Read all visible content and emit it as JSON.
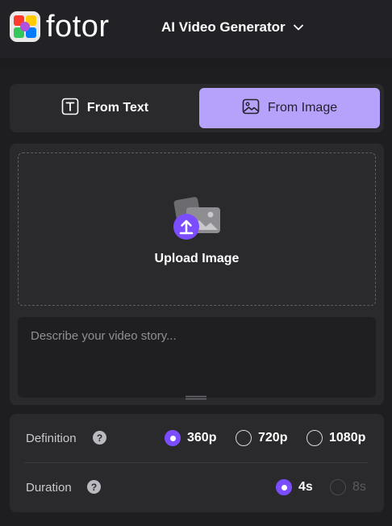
{
  "header": {
    "logo_text": "fotor",
    "product_menu": {
      "label": "AI Video Generator",
      "icon": "chevron-down-icon"
    }
  },
  "tabs": [
    {
      "label": "From Text",
      "icon": "text-icon",
      "active": false
    },
    {
      "label": "From Image",
      "icon": "image-icon",
      "active": true
    }
  ],
  "upload": {
    "label": "Upload Image",
    "icon": "upload-icon"
  },
  "prompt": {
    "placeholder": "Describe your video story...",
    "value": ""
  },
  "settings": {
    "definition": {
      "label": "Definition",
      "help_icon": "help-icon",
      "help_glyph": "?",
      "options": [
        {
          "label": "360p",
          "selected": true
        },
        {
          "label": "720p",
          "selected": false
        },
        {
          "label": "1080p",
          "selected": false
        }
      ]
    },
    "duration": {
      "label": "Duration",
      "help_icon": "help-icon",
      "help_glyph": "?",
      "options": [
        {
          "label": "4s",
          "selected": true,
          "disabled": false
        },
        {
          "label": "8s",
          "selected": false,
          "disabled": true
        }
      ]
    }
  },
  "colors": {
    "accent": "#7c4dff",
    "active_tab": "#b7a2fb",
    "background": "#1c1c1f",
    "card": "#2a2a2d"
  }
}
